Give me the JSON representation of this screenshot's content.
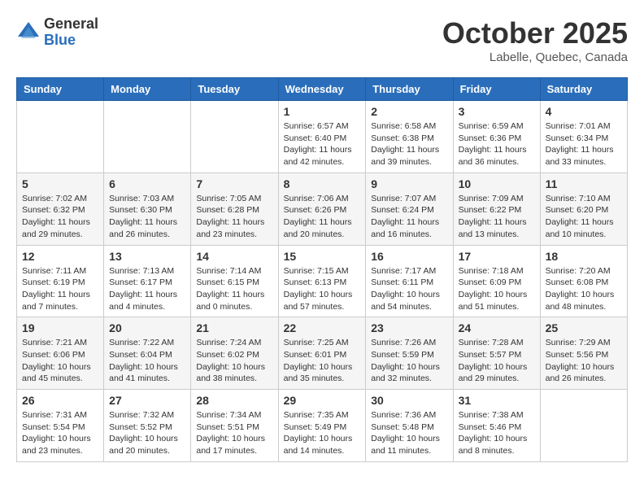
{
  "header": {
    "logo": {
      "general": "General",
      "blue": "Blue"
    },
    "title": "October 2025",
    "location": "Labelle, Quebec, Canada"
  },
  "weekdays": [
    "Sunday",
    "Monday",
    "Tuesday",
    "Wednesday",
    "Thursday",
    "Friday",
    "Saturday"
  ],
  "weeks": [
    [
      {
        "day": "",
        "info": ""
      },
      {
        "day": "",
        "info": ""
      },
      {
        "day": "",
        "info": ""
      },
      {
        "day": "1",
        "info": "Sunrise: 6:57 AM\nSunset: 6:40 PM\nDaylight: 11 hours and 42 minutes."
      },
      {
        "day": "2",
        "info": "Sunrise: 6:58 AM\nSunset: 6:38 PM\nDaylight: 11 hours and 39 minutes."
      },
      {
        "day": "3",
        "info": "Sunrise: 6:59 AM\nSunset: 6:36 PM\nDaylight: 11 hours and 36 minutes."
      },
      {
        "day": "4",
        "info": "Sunrise: 7:01 AM\nSunset: 6:34 PM\nDaylight: 11 hours and 33 minutes."
      }
    ],
    [
      {
        "day": "5",
        "info": "Sunrise: 7:02 AM\nSunset: 6:32 PM\nDaylight: 11 hours and 29 minutes."
      },
      {
        "day": "6",
        "info": "Sunrise: 7:03 AM\nSunset: 6:30 PM\nDaylight: 11 hours and 26 minutes."
      },
      {
        "day": "7",
        "info": "Sunrise: 7:05 AM\nSunset: 6:28 PM\nDaylight: 11 hours and 23 minutes."
      },
      {
        "day": "8",
        "info": "Sunrise: 7:06 AM\nSunset: 6:26 PM\nDaylight: 11 hours and 20 minutes."
      },
      {
        "day": "9",
        "info": "Sunrise: 7:07 AM\nSunset: 6:24 PM\nDaylight: 11 hours and 16 minutes."
      },
      {
        "day": "10",
        "info": "Sunrise: 7:09 AM\nSunset: 6:22 PM\nDaylight: 11 hours and 13 minutes."
      },
      {
        "day": "11",
        "info": "Sunrise: 7:10 AM\nSunset: 6:20 PM\nDaylight: 11 hours and 10 minutes."
      }
    ],
    [
      {
        "day": "12",
        "info": "Sunrise: 7:11 AM\nSunset: 6:19 PM\nDaylight: 11 hours and 7 minutes."
      },
      {
        "day": "13",
        "info": "Sunrise: 7:13 AM\nSunset: 6:17 PM\nDaylight: 11 hours and 4 minutes."
      },
      {
        "day": "14",
        "info": "Sunrise: 7:14 AM\nSunset: 6:15 PM\nDaylight: 11 hours and 0 minutes."
      },
      {
        "day": "15",
        "info": "Sunrise: 7:15 AM\nSunset: 6:13 PM\nDaylight: 10 hours and 57 minutes."
      },
      {
        "day": "16",
        "info": "Sunrise: 7:17 AM\nSunset: 6:11 PM\nDaylight: 10 hours and 54 minutes."
      },
      {
        "day": "17",
        "info": "Sunrise: 7:18 AM\nSunset: 6:09 PM\nDaylight: 10 hours and 51 minutes."
      },
      {
        "day": "18",
        "info": "Sunrise: 7:20 AM\nSunset: 6:08 PM\nDaylight: 10 hours and 48 minutes."
      }
    ],
    [
      {
        "day": "19",
        "info": "Sunrise: 7:21 AM\nSunset: 6:06 PM\nDaylight: 10 hours and 45 minutes."
      },
      {
        "day": "20",
        "info": "Sunrise: 7:22 AM\nSunset: 6:04 PM\nDaylight: 10 hours and 41 minutes."
      },
      {
        "day": "21",
        "info": "Sunrise: 7:24 AM\nSunset: 6:02 PM\nDaylight: 10 hours and 38 minutes."
      },
      {
        "day": "22",
        "info": "Sunrise: 7:25 AM\nSunset: 6:01 PM\nDaylight: 10 hours and 35 minutes."
      },
      {
        "day": "23",
        "info": "Sunrise: 7:26 AM\nSunset: 5:59 PM\nDaylight: 10 hours and 32 minutes."
      },
      {
        "day": "24",
        "info": "Sunrise: 7:28 AM\nSunset: 5:57 PM\nDaylight: 10 hours and 29 minutes."
      },
      {
        "day": "25",
        "info": "Sunrise: 7:29 AM\nSunset: 5:56 PM\nDaylight: 10 hours and 26 minutes."
      }
    ],
    [
      {
        "day": "26",
        "info": "Sunrise: 7:31 AM\nSunset: 5:54 PM\nDaylight: 10 hours and 23 minutes."
      },
      {
        "day": "27",
        "info": "Sunrise: 7:32 AM\nSunset: 5:52 PM\nDaylight: 10 hours and 20 minutes."
      },
      {
        "day": "28",
        "info": "Sunrise: 7:34 AM\nSunset: 5:51 PM\nDaylight: 10 hours and 17 minutes."
      },
      {
        "day": "29",
        "info": "Sunrise: 7:35 AM\nSunset: 5:49 PM\nDaylight: 10 hours and 14 minutes."
      },
      {
        "day": "30",
        "info": "Sunrise: 7:36 AM\nSunset: 5:48 PM\nDaylight: 10 hours and 11 minutes."
      },
      {
        "day": "31",
        "info": "Sunrise: 7:38 AM\nSunset: 5:46 PM\nDaylight: 10 hours and 8 minutes."
      },
      {
        "day": "",
        "info": ""
      }
    ]
  ]
}
